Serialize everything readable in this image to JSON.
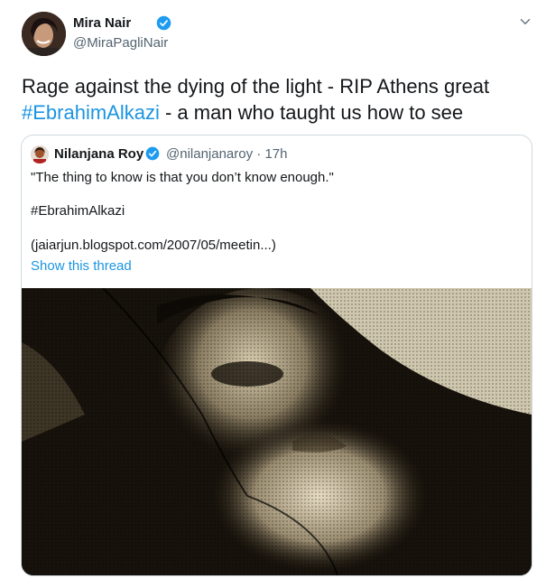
{
  "tweet": {
    "author_name": "Mira Nair",
    "author_handle": "@MiraPagliNair",
    "text_part1": "Rage against the dying of the light - RIP Athens great",
    "hashtag": "#EbrahimAlkazi",
    "text_part2": " - a man who taught us how to see",
    "icons": {
      "verified": "verified-badge-icon",
      "more": "chevron-down-icon"
    },
    "colors": {
      "link": "#1b95e0",
      "verified": "#1d9bf0"
    }
  },
  "quoted_tweet": {
    "author_name": "Nilanjana Roy",
    "author_handle": "@nilanjanaroy",
    "time": "· 17h",
    "line1": "\"The thing to know is that you don’t know enough.\"",
    "line2": "#EbrahimAlkazi",
    "line3": "(jaiarjun.blogspot.com/2007/05/meetin...)",
    "show_thread": "Show this thread"
  }
}
